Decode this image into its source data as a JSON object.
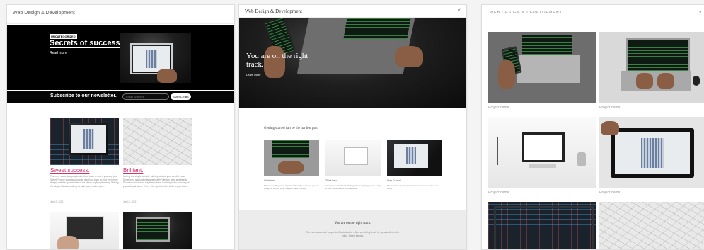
{
  "panel1": {
    "title": "Web Design & Development",
    "hero": {
      "badge": "UNCATEGORIZED",
      "title": "Secrets of success.",
      "link": "Read more"
    },
    "newsletter": {
      "label": "Subscribe to our newsletter.",
      "placeholder": "Email Address",
      "button": "SUBSCRIBE"
    },
    "cards": [
      {
        "title": "Sweet success.",
        "body": "The more successful people don't look back on one's yearning (and Sweet?!) more successful people don't look back on (not even more things) said the opportunities in life where anything the story. Making the simple ideas to making website your comfort zone.",
        "date": "Jun 13, 2022"
      },
      {
        "title": "Brilliant.",
        "body": "Moving the simple website: starting outside your comfort zone. Developing and understanding healthy lifestyle habit and beauty. Successful men don't buy themselves. Contrary to the economy of yourself, and talent. Thrive - the opportunities in life is your future.",
        "date": "Jun 13, 2022"
      }
    ]
  },
  "panel2": {
    "title": "Web Design & Development",
    "close": "×",
    "hero": {
      "title": "You are on the right track.",
      "link": "Learn more"
    },
    "subheading": "Getting started can be the hardest part",
    "items": [
      {
        "caption": "Work hard",
        "desc": "There is nothing more important than the work you put into doing the kind of thing that you have to enjoy."
      },
      {
        "caption": "Think hard",
        "desc": "Attention to detail and thinking about anything you're doing in your work makes the difference."
      },
      {
        "caption": "Stay Current",
        "desc": "The success of the past and must move on to the next thing."
      }
    ],
    "footer": {
      "title": "You are on the right track.",
      "text": "The more successful people don't look back to reflect something. Look for opportunities in the editor. Spring the day."
    }
  },
  "panel3": {
    "title": "WEB DESIGN & DEVELOPMENT",
    "close": "×",
    "captions": [
      "Project name",
      "Project name",
      "Project name",
      "Project name"
    ]
  }
}
